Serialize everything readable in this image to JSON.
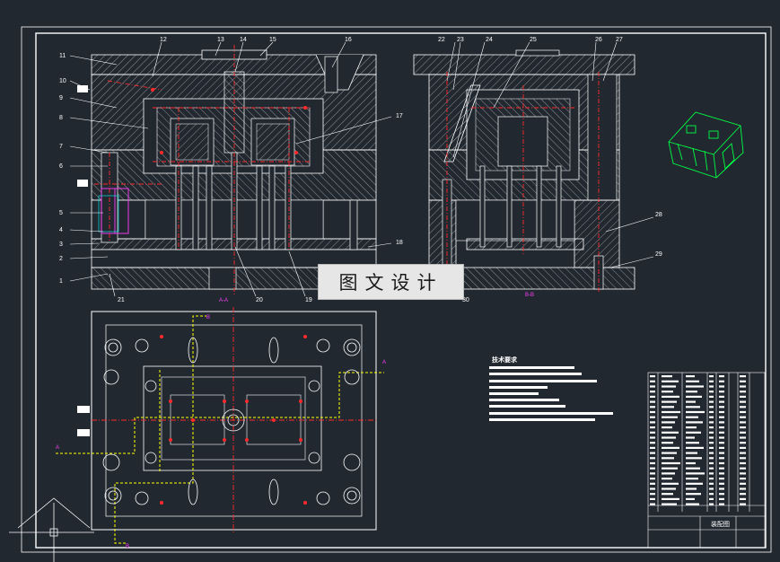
{
  "drawing": {
    "background": "#212830",
    "line_color": "#ffffff",
    "center_line_color": "#ff2a2a",
    "hatch_color": "#cfcfcf",
    "highlight_color": "#ffff00",
    "magenta": "#ff3cff",
    "iso_color": "#00ff44"
  },
  "callouts_left": [
    "11",
    "10",
    "9",
    "8",
    "7",
    "6",
    "5",
    "4",
    "3",
    "2",
    "1"
  ],
  "callouts_top_left": [
    "12",
    "13",
    "14",
    "15",
    "16"
  ],
  "callouts_top_right": [
    "22",
    "23",
    "24",
    "25",
    "26",
    "27"
  ],
  "callouts_right": [
    "17",
    "18",
    "28",
    "29"
  ],
  "callouts_bottom": [
    "21",
    "20",
    "19",
    "30"
  ],
  "section_labels": {
    "a": "A-A",
    "b": "B-B"
  },
  "arrow_letters": {
    "a": "A",
    "b": "B"
  },
  "watermark": "图文设计",
  "tech_requirements": {
    "title": "技术要求",
    "line_count": 9
  },
  "title_block": {
    "title": "装配图"
  }
}
